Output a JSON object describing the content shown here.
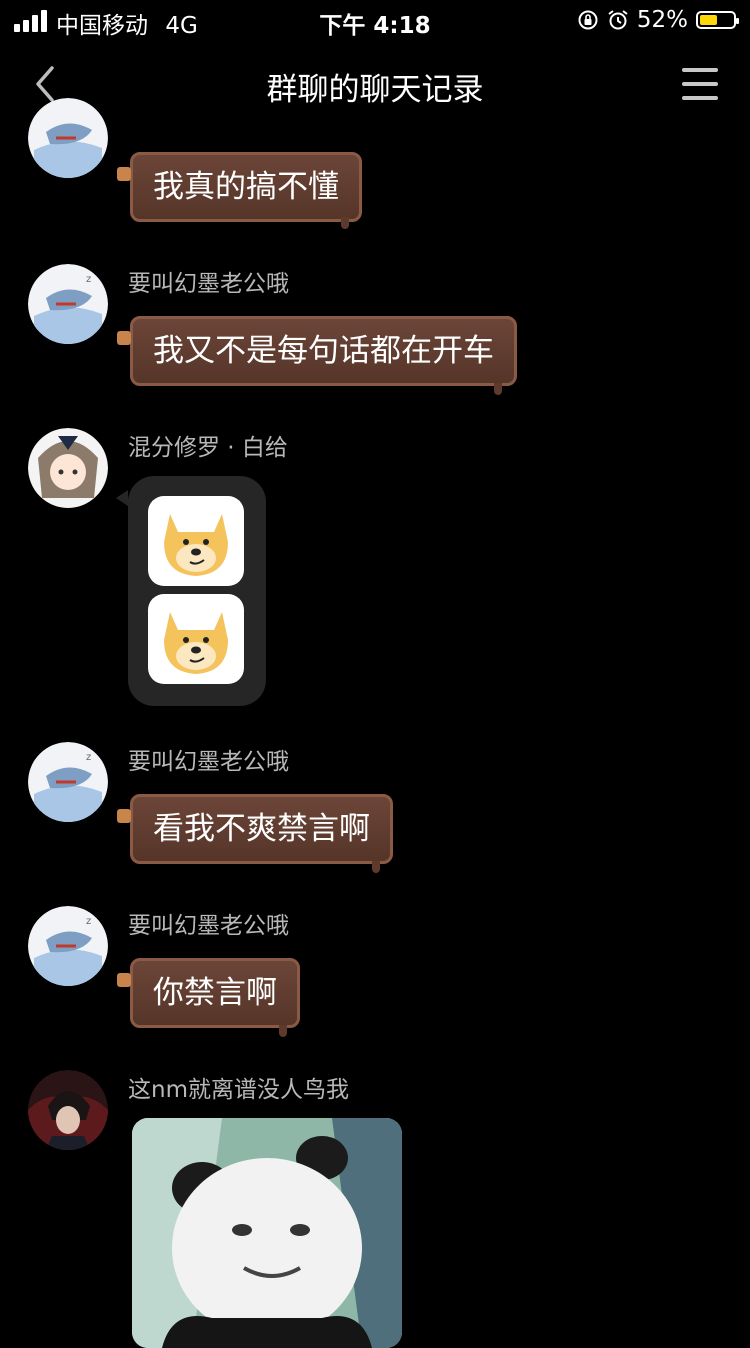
{
  "status_bar": {
    "carrier": "中国移动",
    "network": "4G",
    "time": "下午 4:18",
    "battery_text": "52%",
    "battery_level": 0.52,
    "battery_color": "#ffd60a"
  },
  "nav": {
    "title": "群聊的聊天记录"
  },
  "messages": [
    {
      "sender": "",
      "text": "我真的搞不懂",
      "avatar": "shark-avatar"
    },
    {
      "sender": "要叫幻墨老公哦",
      "text": "我又不是每句话都在开车",
      "avatar": "shark-avatar"
    },
    {
      "sender": "混分修罗 · 白给",
      "text": "",
      "avatar": "anime-girl-avatar",
      "stickers": [
        "doge-sticker",
        "doge-sticker"
      ]
    },
    {
      "sender": "要叫幻墨老公哦",
      "text": "看我不爽禁言啊",
      "avatar": "shark-avatar"
    },
    {
      "sender": "要叫幻墨老公哦",
      "text": "你禁言啊",
      "avatar": "shark-avatar"
    },
    {
      "sender": "这nm就离谱没人鸟我",
      "text": "",
      "avatar": "dark-hair-avatar",
      "image": "panda-meme-image"
    }
  ],
  "colors": {
    "background": "#000000",
    "bubble": "#5e3a2d",
    "nickname": "#b8b8b8"
  }
}
